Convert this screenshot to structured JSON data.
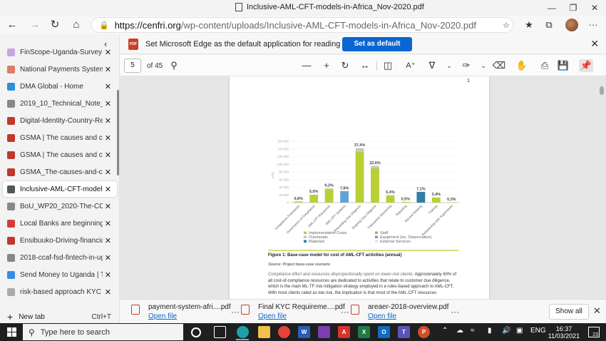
{
  "window": {
    "title": "Inclusive-AML-CFT-models-in-Africa_Nov-2020.pdf",
    "controls": {
      "minimize": "—",
      "restore": "❐",
      "close": "✕"
    }
  },
  "address_bar": {
    "url_main": "https://cenfri.org",
    "url_path": "/wp-content/uploads/Inclusive-AML-CFT-models-in-Africa_Nov-2020.pdf",
    "more": "···"
  },
  "sidebar": {
    "tabs": [
      {
        "label": "FinScope-Uganda-Survey-Report",
        "close": "✕",
        "color": "#c7a6e0"
      },
      {
        "label": "National Payments Systems Act",
        "close": "✕",
        "color": "#e07a6a"
      },
      {
        "label": "DMA Global - Home",
        "close": "✕",
        "color": "#2d8fd6"
      },
      {
        "label": "2019_10_Technical_Note_Risk_Ba",
        "close": "✕",
        "color": "#888888"
      },
      {
        "label": "Digital-Identity-Country-Report",
        "close": "✕",
        "color": "#c0392b"
      },
      {
        "label": "GSMA | The causes and consequ",
        "close": "✕",
        "color": "#c0392b"
      },
      {
        "label": "GSMA | The causes and consequ",
        "close": "✕",
        "color": "#c0392b"
      },
      {
        "label": "GSMA_The-causes-and-consequ",
        "close": "✕",
        "color": "#c0392b"
      },
      {
        "label": "Inclusive-AML-CFT-models-in-Af",
        "close": "✕",
        "color": "#555555",
        "active": true
      },
      {
        "label": "BoU_WP20_2020-The-COVID-19",
        "close": "✕",
        "color": "#888888"
      },
      {
        "label": "Local Banks are beginning to Un",
        "close": "✕",
        "color": "#d63b3b"
      },
      {
        "label": "Ensibuuko-Driving-financial-incl",
        "close": "✕",
        "color": "#c0392b"
      },
      {
        "label": "2018-ccaf-fsd-fintech-in-uganda",
        "close": "✕",
        "color": "#888888"
      },
      {
        "label": "Send Money to Uganda | Transfe",
        "close": "✕",
        "color": "#3a8de0"
      },
      {
        "label": "risk-based approach KYC ugand",
        "close": "✕",
        "color": "#aaaaaa"
      }
    ],
    "new_tab": {
      "label": "New tab",
      "shortcut": "Ctrl+T",
      "icon": "+"
    }
  },
  "notification": {
    "icon_text": "PDF",
    "text": "Set Microsoft Edge as the default application for reading PDF files?",
    "button": "Set as default",
    "close": "✕"
  },
  "pdf_toolbar": {
    "page": "5",
    "of": "of 45"
  },
  "document": {
    "page_number": "1",
    "figure_caption": "Figure 1: Base-case model for cost of AML-CFT activities (annual)",
    "source": "Source: Project base-case scenario",
    "body_lead": "Compliance effort and resources disproportionally spent on lower-risk clients.",
    "body_rest": " Approximately 60% of all cost-of-compliance resources are dedicated to activities that relate to customer due diligence, which is the main ML-TF risk mitigation strategy employed in a rules-based approach to AML-CFT. With most clients rated as low risk, the implication is that most of the AML-CFT resources"
  },
  "chart_data": {
    "type": "bar",
    "stacked": true,
    "ylabel": "USD",
    "ylim": [
      0,
      160000
    ],
    "yticks": [
      "160 000",
      "140 000",
      "120 000",
      "100 000",
      "80 000",
      "60 000",
      "40 000",
      "20 000",
      "0"
    ],
    "grid": true,
    "categories": [
      "Compliance Framework",
      "Governance of Compliance",
      "AML-CFT Resources",
      "AML-CFT Systems",
      "Onboarding Due Diligence",
      "Ongoing Due Diligence",
      "Transaction Monitoring",
      "Reporting",
      "Record Keeping",
      "Training",
      "Relationship with Supervisors"
    ],
    "data_labels": [
      "0,8%",
      "5,6%",
      "9,2%",
      "7,8%",
      "37,4%",
      "22,6%",
      "5,4%",
      "0,5%",
      "7,1%",
      "3,4%",
      "0,3%"
    ],
    "series": [
      {
        "name": "Implementation Costs",
        "color": "#b9cf34",
        "values": [
          3000,
          20000,
          35000,
          0,
          132000,
          90000,
          18000,
          2000,
          0,
          13000,
          1000
        ]
      },
      {
        "name": "Overheads",
        "color": "#c7c7c7",
        "values": [
          0,
          1000,
          2000,
          0,
          10000,
          6000,
          1500,
          0,
          0,
          500,
          0
        ]
      },
      {
        "name": "Materials",
        "color": "#2f7fa6",
        "values": [
          0,
          0,
          0,
          0,
          0,
          0,
          0,
          0,
          28000,
          0,
          0
        ]
      },
      {
        "name": "Staff",
        "color": "#a6bd24",
        "values": [
          0,
          0,
          0,
          0,
          0,
          0,
          0,
          0,
          0,
          0,
          0
        ]
      },
      {
        "name": "Equipment (inc. Depreciation)",
        "color": "#5fa3d6",
        "values": [
          0,
          0,
          0,
          30000,
          0,
          0,
          0,
          0,
          0,
          0,
          0
        ]
      },
      {
        "name": "External Services",
        "color": "#e3e3e3",
        "values": [
          0,
          0,
          0,
          0,
          0,
          0,
          0,
          0,
          0,
          0,
          0
        ]
      }
    ],
    "legend_position": "bottom"
  },
  "downloads": [
    {
      "name": "payment-system-afri....pdf",
      "action": "Open file",
      "more": "···"
    },
    {
      "name": "Final KYC Requireme....pdf",
      "action": "Open file",
      "more": "···"
    },
    {
      "name": "areaer-2018-overview.pdf",
      "action": "Open file",
      "more": "···"
    }
  ],
  "downloads_bar": {
    "show_all": "Show all",
    "close": "✕"
  },
  "taskbar": {
    "search_placeholder": "Type here to search",
    "lang": "ENG",
    "time": "16:37",
    "date": "11/03/2021",
    "notifications": "23"
  }
}
